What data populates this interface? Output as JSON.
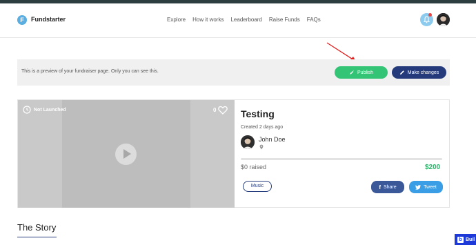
{
  "header": {
    "logo_letter": "F",
    "brand": "Fundstarter",
    "nav": [
      "Explore",
      "How it works",
      "Leaderboard",
      "Raise Funds",
      "FAQs"
    ]
  },
  "banner": {
    "text": "This is a preview of your fundraiser page. Only you can see this.",
    "publish_label": "Publish",
    "changes_label": "Make changes"
  },
  "media": {
    "status": "Not Launched",
    "likes": "0"
  },
  "campaign": {
    "title": "Testing",
    "created": "Created 2 days ago",
    "owner": "John Doe",
    "raised": "$0 raised",
    "goal": "$200",
    "progress": 0,
    "tag": "Music",
    "share_label": "Share",
    "tweet_label": "Tweet"
  },
  "story": {
    "heading": "The Story"
  },
  "badge": {
    "label": "Buil"
  },
  "colors": {
    "publish": "#33c475",
    "primary": "#243a7a",
    "facebook": "#3b5998",
    "twitter": "#3a9ee6",
    "goal": "#2db36a"
  }
}
